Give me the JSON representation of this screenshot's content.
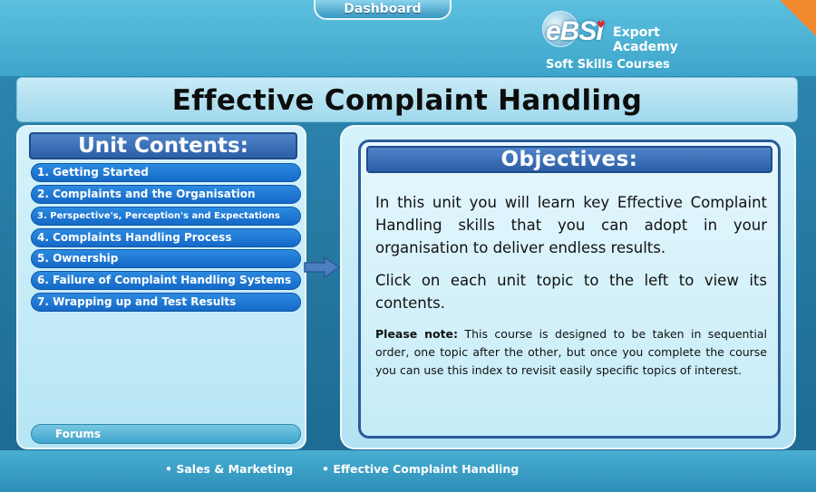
{
  "header": {
    "dashboard_label": "Dashboard",
    "logo": {
      "brand": "eBSI",
      "line1": "Export",
      "line2": "Academy",
      "tagline": "Soft Skills Courses"
    }
  },
  "page": {
    "title": "Effective Complaint Handling"
  },
  "sidebar": {
    "title": "Unit Contents:",
    "items": [
      {
        "label": "1. Getting Started"
      },
      {
        "label": "2. Complaints and the Organisation"
      },
      {
        "label": "3. Perspective's, Perception's and Expectations"
      },
      {
        "label": "4. Complaints Handling Process"
      },
      {
        "label": "5. Ownership"
      },
      {
        "label": "6. Failure of Complaint Handling Systems"
      },
      {
        "label": "7. Wrapping up and Test Results"
      }
    ],
    "forums_label": "Forums"
  },
  "objectives": {
    "title": "Objectives:",
    "paragraph1": "In this unit you will learn key Effective Complaint Handling skills that you can adopt in your organisation to deliver endless results.",
    "paragraph2": "Click on each unit topic to the left to view its contents.",
    "note_label": "Please note:",
    "note_text": " This course is designed to be taken in sequential order, one topic after the other, but once you complete the course you can use this index to revisit easily specific topics of interest."
  },
  "footer": {
    "items": [
      "• Sales & Marketing",
      "• Effective Complaint Handling"
    ]
  },
  "colors": {
    "accent_orange": "#f18a2f",
    "menu_blue": "#1569c7",
    "header_blue": "#2c5fa6",
    "frame_blue": "#2f8ab3"
  }
}
